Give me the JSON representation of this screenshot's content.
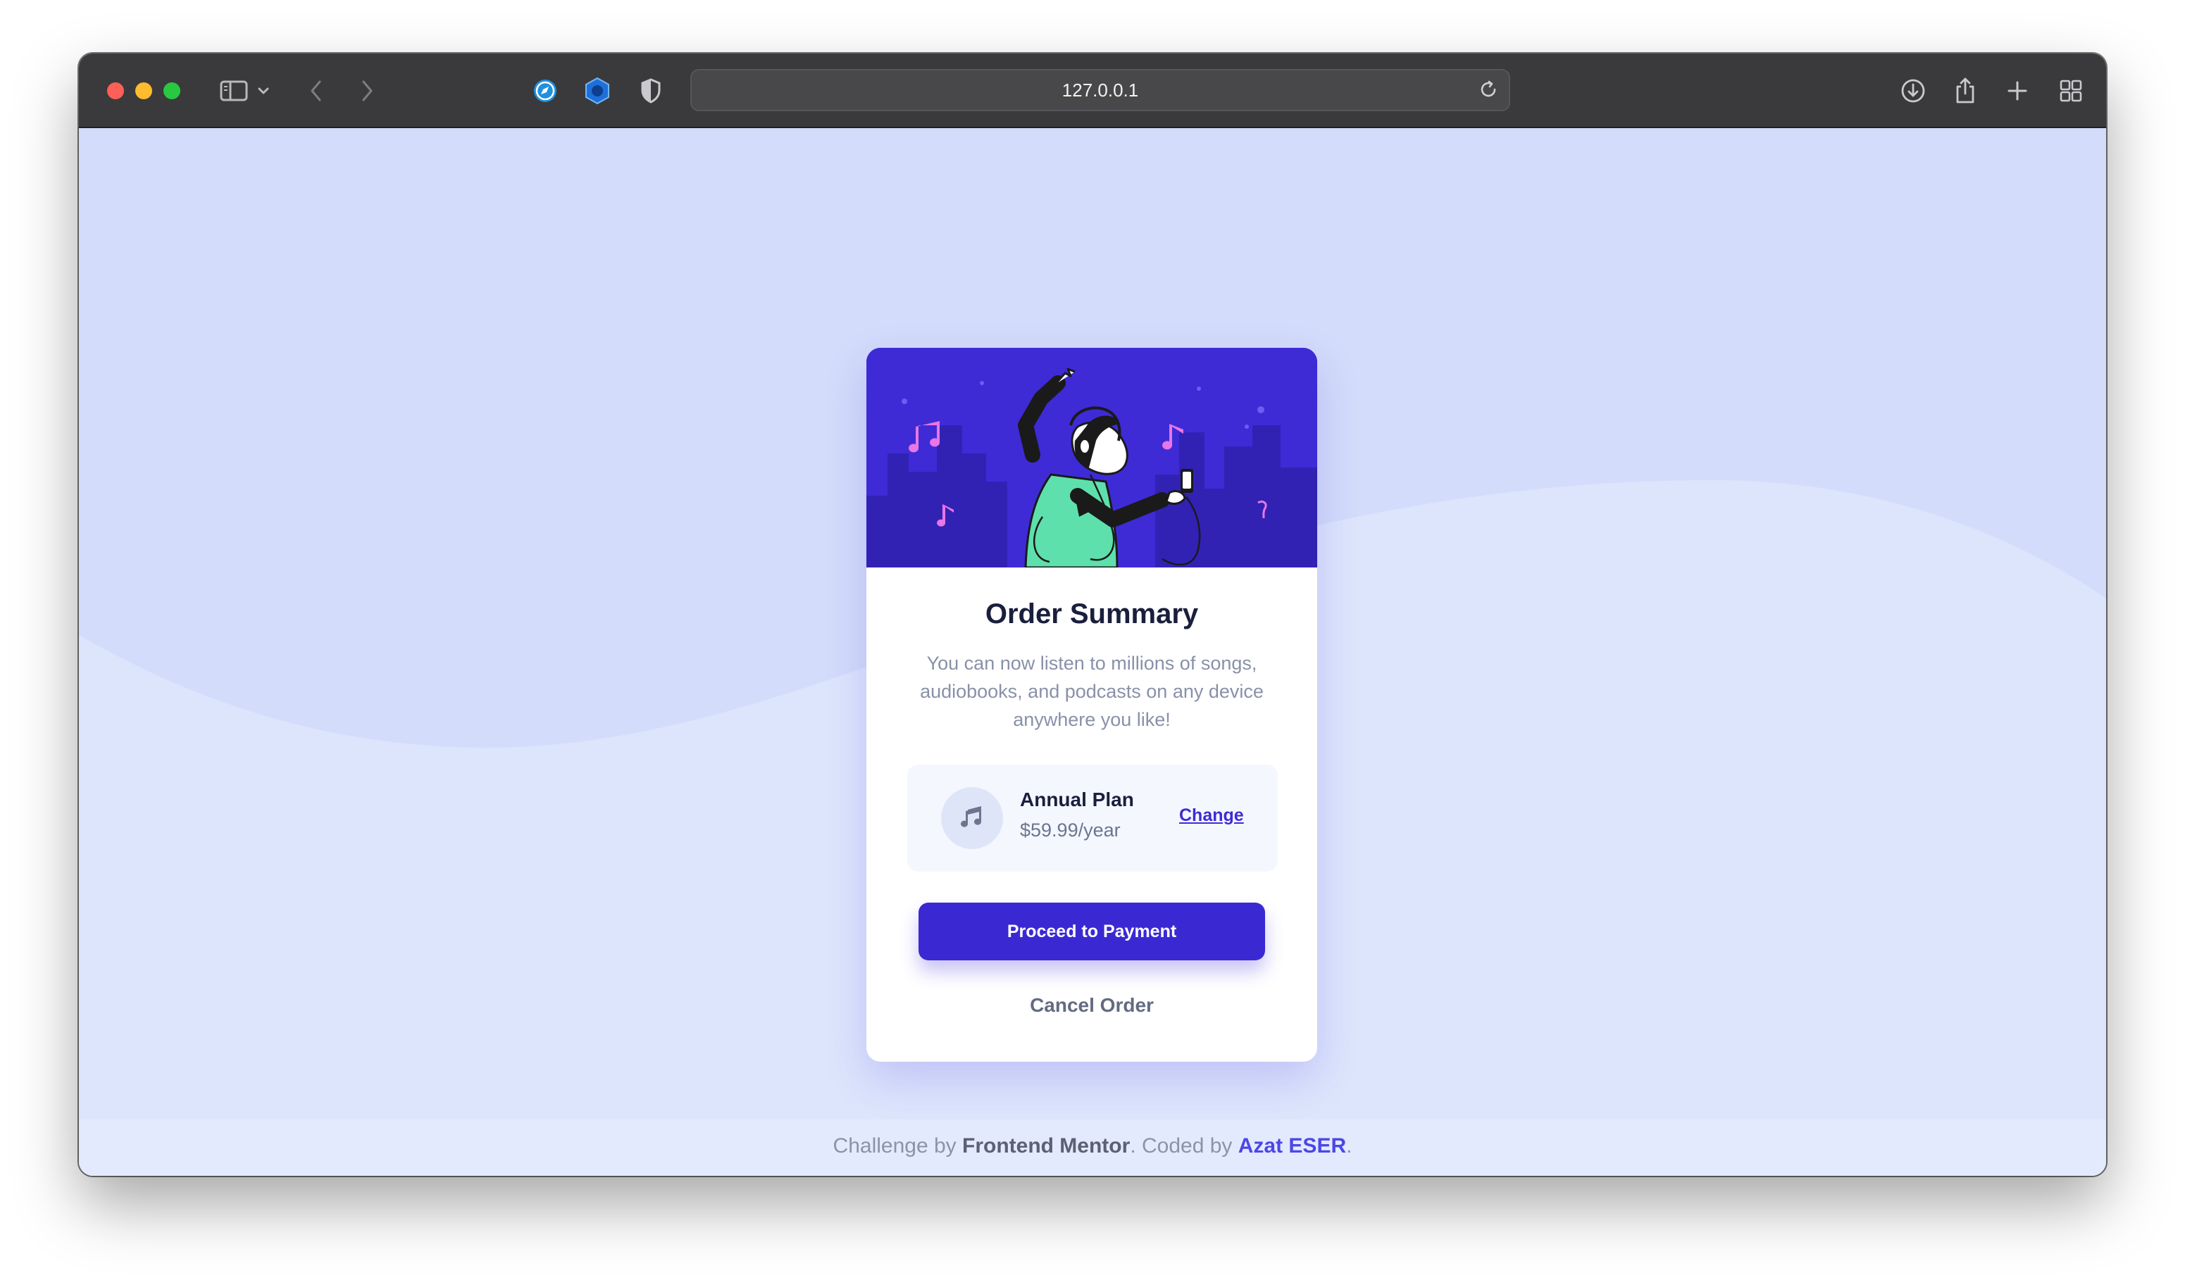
{
  "browser": {
    "url": "127.0.0.1",
    "icons": {
      "sidebar": "sidebar-icon",
      "chevron": "chevron-down-icon",
      "back": "back-arrow-icon",
      "forward": "forward-arrow-icon",
      "ext1": "compass-extension-icon",
      "ext2": "hex-extension-icon",
      "ext3": "shield-extension-icon",
      "reload": "reload-icon",
      "download": "download-icon",
      "share": "share-icon",
      "new_tab": "plus-icon",
      "tabs": "tab-overview-icon"
    },
    "colors": {
      "toolbar": "#3a3a3c",
      "red": "#fe5f57",
      "yellow": "#febc2e",
      "green": "#28c840"
    }
  },
  "page": {
    "background": "#d6e0fc",
    "card": {
      "title": "Order Summary",
      "description": "You can now listen to millions of songs, audiobooks, and podcasts on any device anywhere you like!",
      "plan": {
        "icon": "music-note-icon",
        "name": "Annual Plan",
        "price": "$59.99/year",
        "change_label": "Change"
      },
      "proceed_label": "Proceed to Payment",
      "cancel_label": "Cancel Order",
      "accent": "#3a29d3"
    },
    "footer": {
      "prefix": "Challenge by ",
      "challenge_by": "Frontend Mentor",
      "middle": ". Coded by ",
      "author": "Azat ESER",
      "suffix": "."
    }
  }
}
